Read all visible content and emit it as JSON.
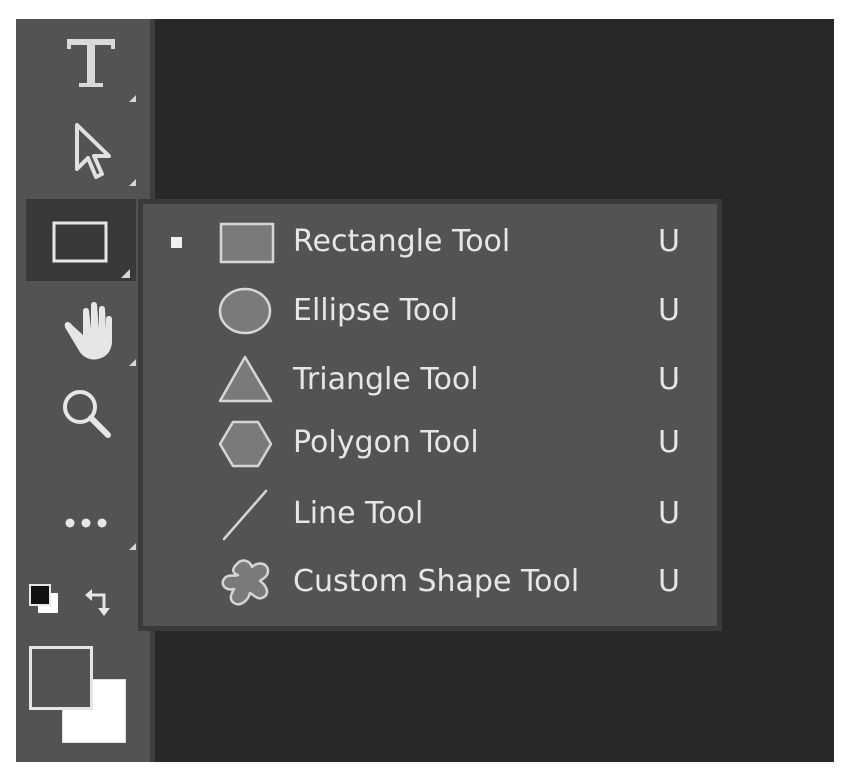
{
  "toolbar": {
    "tools": [
      {
        "name": "type-tool",
        "icon": "type-icon"
      },
      {
        "name": "path-selection-tool",
        "icon": "arrow-select-icon"
      },
      {
        "name": "rectangle-tool",
        "icon": "rectangle-icon",
        "active": true
      },
      {
        "name": "hand-tool",
        "icon": "hand-icon"
      },
      {
        "name": "zoom-tool",
        "icon": "zoom-icon"
      },
      {
        "name": "edit-toolbar",
        "icon": "more-icon"
      }
    ],
    "colors": {
      "foreground": "#535353",
      "background": "#ffffff"
    }
  },
  "flyout": {
    "items": [
      {
        "label": "Rectangle Tool",
        "shortcut": "U",
        "icon": "rectangle-icon",
        "selected": true
      },
      {
        "label": "Ellipse Tool",
        "shortcut": "U",
        "icon": "ellipse-icon"
      },
      {
        "label": "Triangle Tool",
        "shortcut": "U",
        "icon": "triangle-icon"
      },
      {
        "label": "Polygon Tool",
        "shortcut": "U",
        "icon": "polygon-icon"
      },
      {
        "label": "Line Tool",
        "shortcut": "U",
        "icon": "line-icon"
      },
      {
        "label": "Custom Shape Tool",
        "shortcut": "U",
        "icon": "custom-shape-icon"
      }
    ]
  }
}
